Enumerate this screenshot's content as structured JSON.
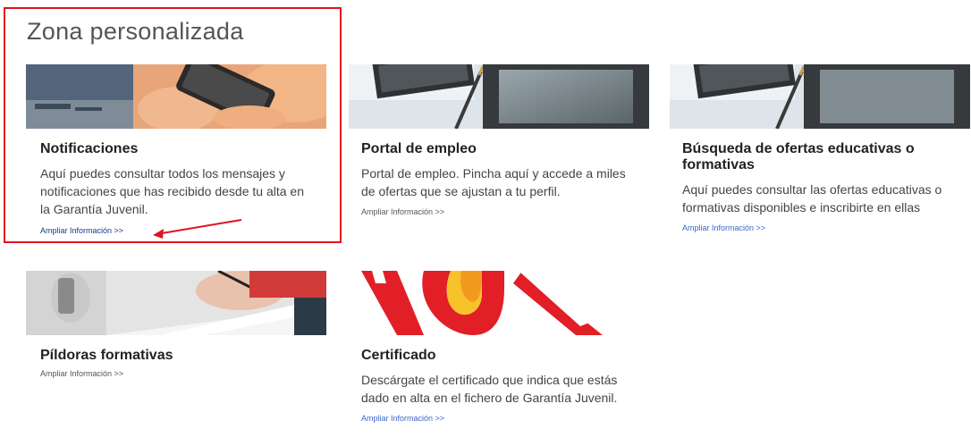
{
  "section": {
    "title": "Zona personalizada"
  },
  "cards": [
    {
      "title": "Notificaciones",
      "description": "Aquí puedes consultar todos los mensajes y notificaciones que has recibido desde tu alta en la Garantía Juvenil.",
      "link": "Ampliar Información >>"
    },
    {
      "title": "Portal de empleo",
      "description": "Portal de empleo. Pincha aquí y accede a miles de ofertas que se ajustan a tu perfil.",
      "link": "Ampliar Información >>"
    },
    {
      "title": "Búsqueda de ofertas educativas o formativas",
      "description": "Aquí puedes consultar las ofertas educativas o formativas disponibles e inscribirte en ellas",
      "link": "Ampliar Información >>"
    },
    {
      "title": "Píldoras formativas",
      "description": "",
      "link": "Ampliar Información >>"
    },
    {
      "title": "Certificado",
      "description": "Descárgate el certificado que indica que estás dado en alta en el fichero de Garantía Juvenil.",
      "link": "Ampliar Información >>"
    }
  ],
  "colors": {
    "highlight": "#e0141e",
    "link": "#3a66c8"
  }
}
